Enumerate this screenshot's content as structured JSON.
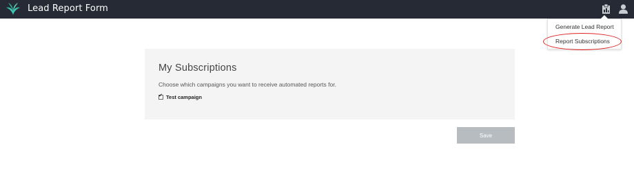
{
  "header": {
    "title": "Lead Report Form",
    "icons": {
      "logo": "leaf-logo-icon",
      "reports": "clipboard-icon",
      "user": "user-icon"
    },
    "colors": {
      "bar": "#252a34",
      "logo": "#3fc6b0"
    }
  },
  "dropdown": {
    "items": [
      {
        "label": "Generate Lead Report"
      },
      {
        "label": "Report Subscriptions"
      }
    ],
    "highlight_color": "#e02020"
  },
  "subscriptions": {
    "title": "My Subscriptions",
    "description": "Choose which campaigns you want to receive automated reports for.",
    "campaigns": [
      {
        "label": "Test campaign",
        "checked": true
      }
    ]
  },
  "actions": {
    "save_label": "Save"
  }
}
